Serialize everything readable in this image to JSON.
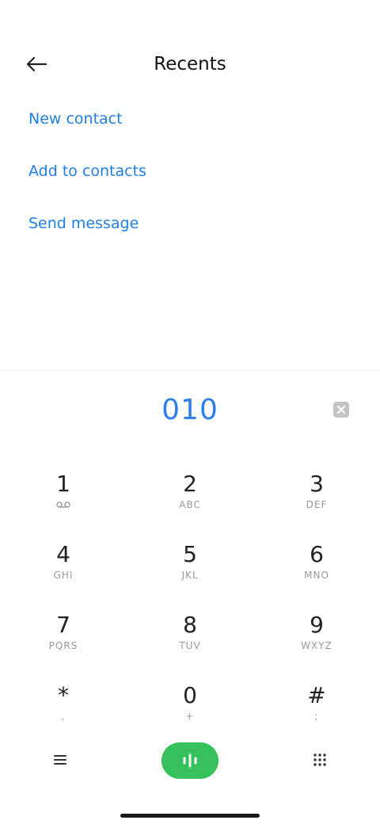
{
  "header": {
    "title": "Recents",
    "back_icon": "arrow-left-icon"
  },
  "actions": [
    {
      "label": "New contact"
    },
    {
      "label": "Add to contacts"
    },
    {
      "label": "Send message"
    }
  ],
  "dialer": {
    "number": "010",
    "backspace_icon": "backspace-icon"
  },
  "keypad": [
    {
      "digit": "1",
      "letters": "",
      "sub_icon": "voicemail-icon"
    },
    {
      "digit": "2",
      "letters": "ABC"
    },
    {
      "digit": "3",
      "letters": "DEF"
    },
    {
      "digit": "4",
      "letters": "GHI"
    },
    {
      "digit": "5",
      "letters": "JKL"
    },
    {
      "digit": "6",
      "letters": "MNO"
    },
    {
      "digit": "7",
      "letters": "PQRS"
    },
    {
      "digit": "8",
      "letters": "TUV"
    },
    {
      "digit": "9",
      "letters": "WXYZ"
    },
    {
      "digit": "*",
      "letters": ","
    },
    {
      "digit": "0",
      "letters": "+"
    },
    {
      "digit": "#",
      "letters": ";"
    }
  ],
  "bottom_bar": {
    "menu_icon": "menu-icon",
    "call_icon": "call-icon",
    "dialpad_icon": "dialpad-icon"
  },
  "colors": {
    "accent": "#1f7fe5",
    "number": "#2e80e6",
    "call_button": "#36c15d"
  }
}
